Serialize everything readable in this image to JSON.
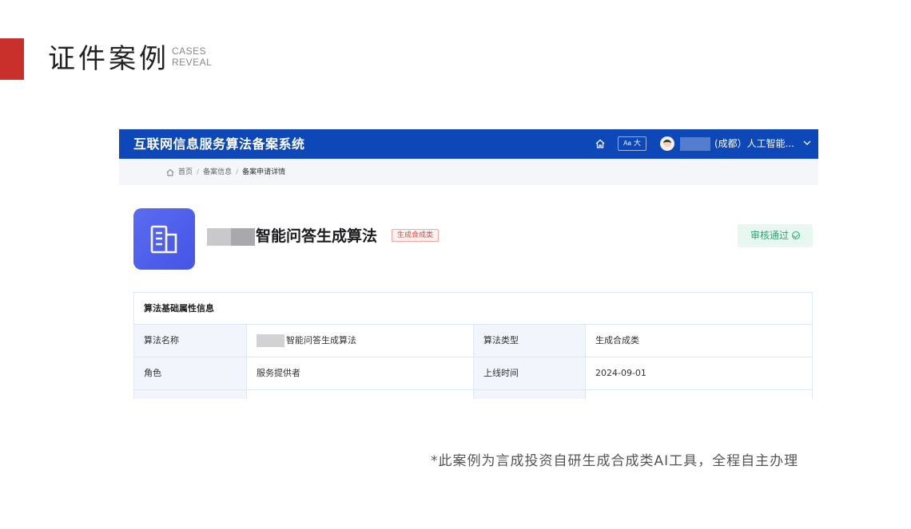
{
  "slide": {
    "title": "证件案例",
    "subtitle_line1": "CASES",
    "subtitle_line2": "REVEAL",
    "accent_color": "#c9302c",
    "footnote": "*此案例为言成投资自研生成合成类AI工具，全程自主办理"
  },
  "app": {
    "system_title": "互联网信息服务算法备案系统",
    "header_bg": "#0d47b8",
    "font_size_button_small": "Aa",
    "font_size_button_large": "大",
    "user_label": "(成都）人工智能...",
    "icons": {
      "home": "home-icon",
      "avatar": "avatar-icon",
      "dropdown": "chevron-down-icon"
    }
  },
  "breadcrumb": {
    "items": [
      "首页",
      "备案信息",
      "备案申请详情"
    ],
    "separator": "/"
  },
  "algorithm": {
    "title": "智能问答生成算法",
    "type_tag": "生成合成类",
    "status": "审核通过",
    "icon": "building-icon"
  },
  "info_table": {
    "heading": "算法基础属性信息",
    "rows": [
      {
        "label1": "算法名称",
        "value1": "智能问答生成算法",
        "label2": "算法类型",
        "value2": "生成合成类"
      },
      {
        "label1": "角色",
        "value1": "服务提供者",
        "label2": "上线时间",
        "value2": "2024-09-01"
      }
    ]
  }
}
